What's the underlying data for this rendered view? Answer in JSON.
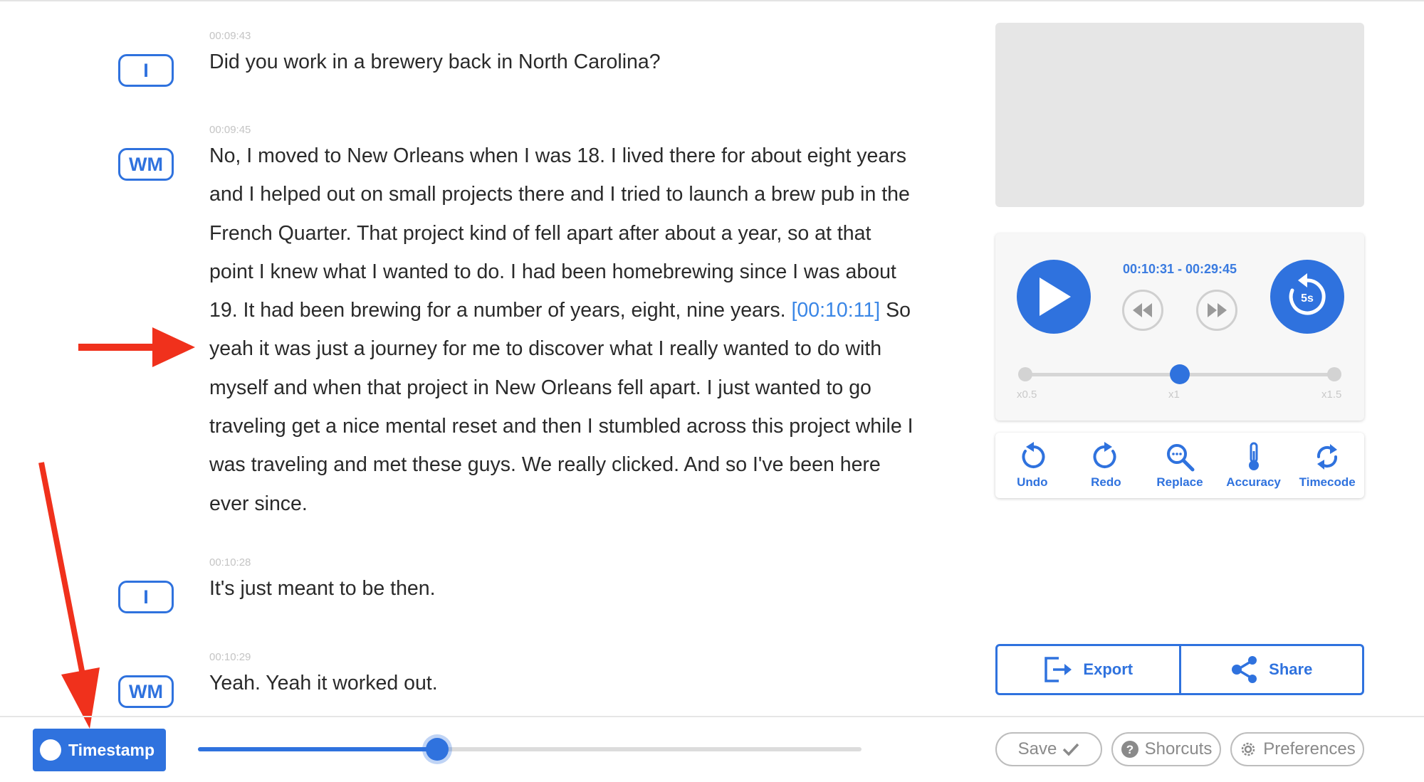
{
  "transcript": [
    {
      "timestamp": "00:09:43",
      "speaker": "I",
      "text": "Did you work in a brewery back in North Carolina?"
    },
    {
      "timestamp": "00:09:45",
      "speaker": "WM",
      "text_before": "No, I moved to New Orleans when I was 18. I lived there for about eight years and I helped out on small projects there and I tried to launch a brew pub in the French Quarter. That project kind of fell apart after about a year, so at that point I knew what I wanted to do. I had been homebrewing since I was about 19. It had been brewing for a number of years, eight, nine years. ",
      "inline_timestamp": "[00:10:11]",
      "text_after": " So yeah it was just a journey for me to discover what I really wanted to do with myself and when that project in New Orleans fell apart. I just wanted to go traveling get a nice mental reset and then I stumbled across this project while I was traveling and met these guys. We really clicked. And so I've been here ever since."
    },
    {
      "timestamp": "00:10:28",
      "speaker": "I",
      "text": "It's just meant to be then."
    },
    {
      "timestamp": "00:10:29",
      "speaker": "WM",
      "text": " Yeah. Yeah it worked out."
    }
  ],
  "player": {
    "time_range": "00:10:31 - 00:29:45",
    "replay_label": "5s",
    "speed_labels": [
      "x0.5",
      "x1",
      "x1.5"
    ],
    "speed_selected": "x1"
  },
  "tools": [
    {
      "label": "Undo",
      "icon": "undo-icon"
    },
    {
      "label": "Redo",
      "icon": "redo-icon"
    },
    {
      "label": "Replace",
      "icon": "search-replace-icon"
    },
    {
      "label": "Accuracy",
      "icon": "thermometer-icon"
    },
    {
      "label": "Timecode",
      "icon": "sync-icon"
    }
  ],
  "actions": {
    "export_label": "Export",
    "share_label": "Share"
  },
  "bottom_bar": {
    "timestamp_label": "Timestamp",
    "progress_fraction": 0.36,
    "save_label": "Save",
    "shortcuts_label": "Shorcuts",
    "preferences_label": "Preferences"
  },
  "colors": {
    "accent": "#2f72de",
    "annotation_arrow": "#f0311c",
    "inline_timestamp": "#3a86e6"
  }
}
